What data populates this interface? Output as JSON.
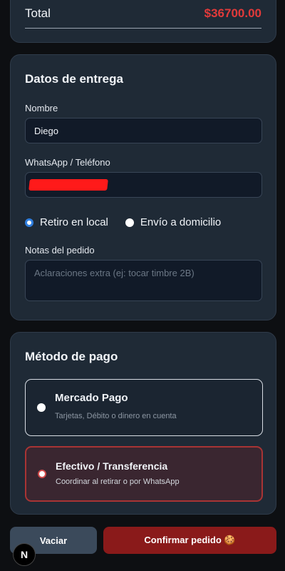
{
  "summary": {
    "total_label": "Total",
    "total_value": "$36700.00"
  },
  "delivery": {
    "title": "Datos de entrega",
    "name_label": "Nombre",
    "name_value": "Diego",
    "phone_label": "WhatsApp / Teléfono",
    "phone_value": "",
    "shipping_options": [
      {
        "label": "Retiro en local",
        "selected": true
      },
      {
        "label": "Envío a domicilio",
        "selected": false
      }
    ],
    "notes_label": "Notas del pedido",
    "notes_placeholder": "Aclaraciones extra (ej: tocar timbre 2B)"
  },
  "payment": {
    "title": "Método de pago",
    "options": [
      {
        "title": "Mercado Pago",
        "subtitle": "Tarjetas, Débito o dinero en cuenta",
        "selected": false
      },
      {
        "title": "Efectivo / Transferencia",
        "subtitle": "Coordinar al retirar o por WhatsApp",
        "selected": true
      }
    ]
  },
  "actions": {
    "clear_label": "Vaciar",
    "confirm_label": "Confirmar pedido 🍪"
  },
  "dev_badge": {
    "letter": "N",
    "icon": "nextjs-icon"
  },
  "colors": {
    "accent_red": "#e23a3a",
    "confirm_bg": "#8a1a1a",
    "radio_blue": "#2f7fe0",
    "card_bg": "#1f2a36"
  }
}
